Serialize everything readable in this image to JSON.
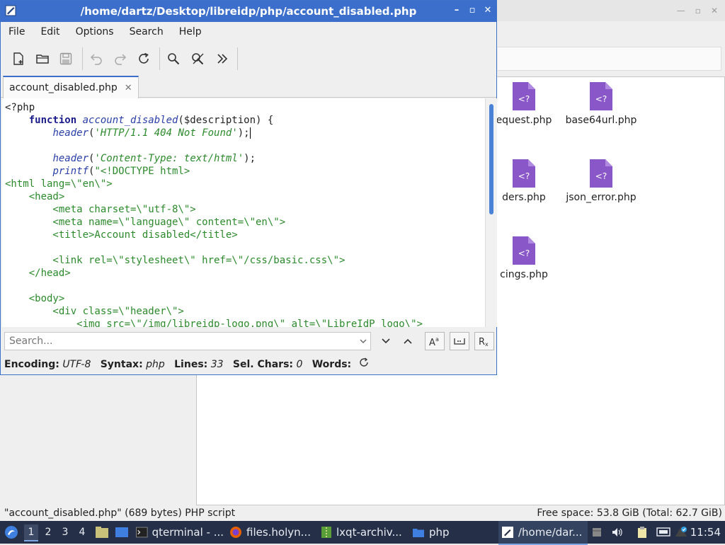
{
  "colors": {
    "titlebar_active": "#3b6fcb",
    "php_icon": "#8a57c9",
    "taskbar": "#253048",
    "code_keyword": "#1a1a8c",
    "code_function": "#2a3fa8",
    "code_string": "#2c8a2c"
  },
  "editor": {
    "title": "/home/dartz/Desktop/libreidp/php/account_disabled.php",
    "menu": [
      "File",
      "Edit",
      "Options",
      "Search",
      "Help"
    ],
    "toolbar_icons": [
      "new-file-icon",
      "open-folder-icon",
      "save-icon",
      "undo-icon",
      "redo-icon",
      "reload-icon",
      "find-icon",
      "find-replace-icon",
      "more-icon"
    ],
    "tab_label": "account_disabled.php",
    "search_placeholder": "Search...",
    "status": {
      "encoding_label": "Encoding:",
      "encoding_value": "UTF-8",
      "syntax_label": "Syntax:",
      "syntax_value": "php",
      "lines_label": "Lines:",
      "lines_value": "33",
      "sel_label": "Sel. Chars:",
      "sel_value": "0",
      "words_label": "Words:"
    }
  },
  "file_manager": {
    "files": [
      "equest.php",
      "base64url.php",
      "ders.php",
      "json_error.php",
      "cings.php"
    ],
    "status_left": "\"account_disabled.php\" (689 bytes) PHP script",
    "status_right": "Free space: 53.8 GiB (Total: 62.7 GiB)"
  },
  "taskbar": {
    "desktops": [
      "1",
      "2",
      "3",
      "4"
    ],
    "tasks": [
      {
        "label": "qterminal - ...",
        "icon": "terminal-icon"
      },
      {
        "label": "files.holyn...",
        "icon": "firefox-icon"
      },
      {
        "label": "lxqt-archiv...",
        "icon": "archiver-icon"
      },
      {
        "label": "php",
        "icon": "folder-icon"
      },
      {
        "label": "/home/dar...",
        "icon": "editor-icon"
      }
    ],
    "clock": "11:54"
  }
}
